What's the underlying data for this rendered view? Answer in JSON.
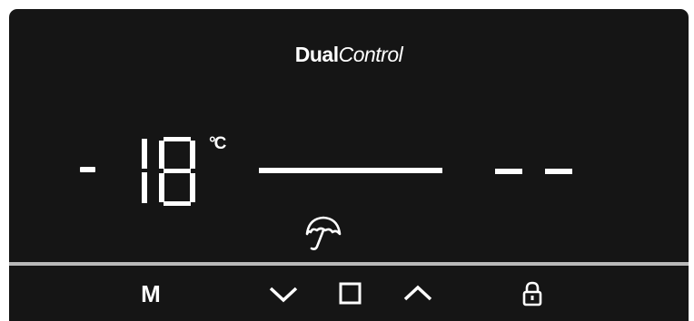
{
  "brand": {
    "bold": "Dual",
    "italic": "Control"
  },
  "display": {
    "sign": "-",
    "temperature": "18",
    "unit": "°C",
    "right_value": "- -"
  },
  "icons": {
    "mode": "umbrella-icon",
    "down": "chevron-down-icon",
    "stop": "square-icon",
    "up": "chevron-up-icon",
    "lock": "lock-icon"
  },
  "buttons": {
    "mode_label": "M"
  },
  "colors": {
    "panel": "#151515",
    "segment_on": "#ffffff",
    "separator": "#b9b9b9"
  }
}
